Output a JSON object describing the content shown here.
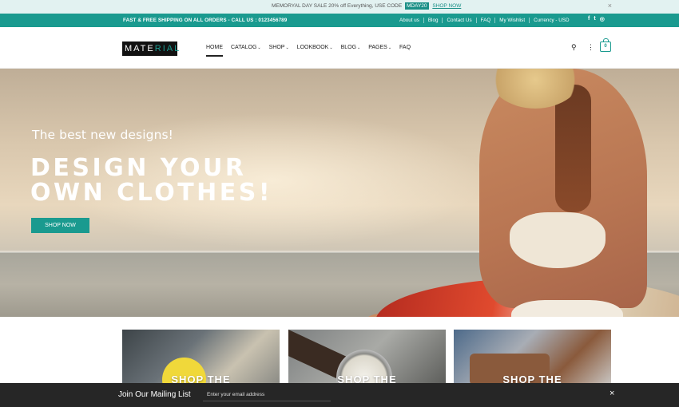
{
  "announcement": {
    "text": "MEMORYAL DAY SALE 20% off Everything, USE CODE",
    "code": "MDAY20",
    "link": "SHOP NOW",
    "close_icon": "×"
  },
  "topbar": {
    "shipping": "FAST & FREE SHIPPING ON ALL ORDERS - CALL US : 0123456789",
    "links": [
      "About us",
      "Blog",
      "Contact Us",
      "FAQ",
      "My Wishlist",
      "Currency - USD"
    ],
    "social": [
      "f",
      "t",
      "◎"
    ]
  },
  "header": {
    "logo": {
      "part1": "MATE",
      "part2": "RIAL"
    },
    "nav": [
      {
        "label": "HOME",
        "caret": ""
      },
      {
        "label": "CATALOG",
        "caret": "⌄"
      },
      {
        "label": "SHOP",
        "caret": "⌄"
      },
      {
        "label": "LOOKBOOK",
        "caret": "⌄"
      },
      {
        "label": "BLOG",
        "caret": "⌄"
      },
      {
        "label": "PAGES",
        "caret": "⌄"
      },
      {
        "label": "FAQ",
        "caret": ""
      }
    ],
    "search_icon": "⚲",
    "more_icon": "⋮",
    "cart_count": "0"
  },
  "hero": {
    "subtitle": "The best new designs!",
    "title_line1": "DESIGN YOUR",
    "title_line2": "OWN CLOTHES!",
    "button": "SHOP NOW"
  },
  "cards": [
    {
      "label": "SHOP THE"
    },
    {
      "label": "SHOP THE"
    },
    {
      "label": "SHOP THE"
    }
  ],
  "mailing": {
    "title": "Join Our Mailing List",
    "placeholder": "Enter your email address",
    "close_icon": "×"
  },
  "colors": {
    "accent": "#1a9a8f",
    "announce_bg": "#e2f2f1",
    "mail_bar_bg": "#262626"
  }
}
